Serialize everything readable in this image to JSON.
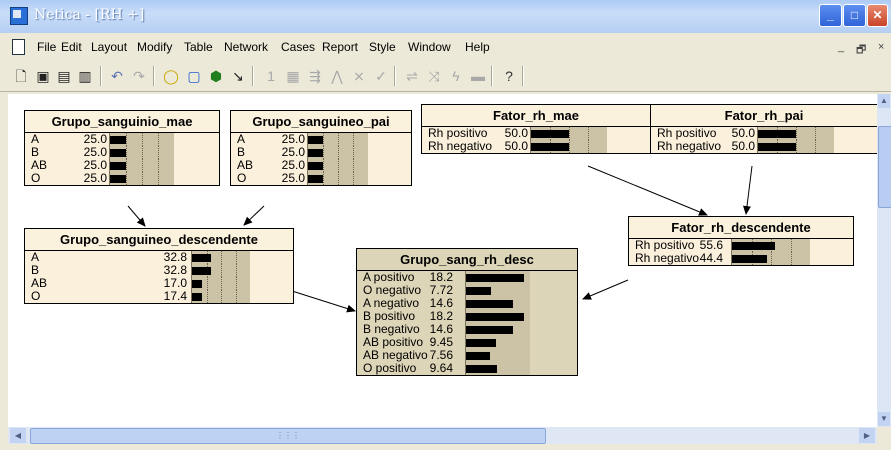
{
  "window": {
    "title": "Netica - [RH +]",
    "minimize": "_",
    "maximize": "□",
    "close": "✕"
  },
  "menu": [
    {
      "label": "File"
    },
    {
      "label": "Edit"
    },
    {
      "label": "Layout"
    },
    {
      "label": "Modify"
    },
    {
      "label": "Table"
    },
    {
      "label": "Network"
    },
    {
      "label": "Cases"
    },
    {
      "label": "Report"
    },
    {
      "label": "Style"
    },
    {
      "label": "Window"
    },
    {
      "label": "Help"
    }
  ],
  "mdi": {
    "minimize": "_",
    "restore": "🗗",
    "close": "×"
  },
  "toolbar": [
    {
      "icon": "new-icon"
    },
    {
      "icon": "save-icon"
    },
    {
      "icon": "compile-icon"
    },
    {
      "icon": "open-icon"
    },
    {
      "icon": "undo-icon"
    },
    {
      "icon": "redo-icon"
    },
    {
      "icon": "nature-node-icon"
    },
    {
      "icon": "decision-node-icon"
    },
    {
      "icon": "utility-node-icon"
    },
    {
      "icon": "link-tool-icon"
    },
    {
      "icon": "one-icon"
    },
    {
      "icon": "table-icon"
    },
    {
      "icon": "arrange-icon"
    },
    {
      "icon": "absorb-icon"
    },
    {
      "icon": "reverse-icon"
    },
    {
      "icon": "check-icon"
    },
    {
      "icon": "transfer-icon"
    },
    {
      "icon": "sensitivity-icon"
    },
    {
      "icon": "findings-icon"
    },
    {
      "icon": "bar-icon"
    },
    {
      "icon": "help-icon"
    }
  ],
  "nodes": {
    "grupo_mae": {
      "title": "Grupo_sanguinio_mae",
      "states": [
        {
          "label": "A",
          "value": "25.0",
          "p": 25.0
        },
        {
          "label": "B",
          "value": "25.0",
          "p": 25.0
        },
        {
          "label": "AB",
          "value": "25.0",
          "p": 25.0
        },
        {
          "label": "O",
          "value": "25.0",
          "p": 25.0
        }
      ]
    },
    "grupo_pai": {
      "title": "Grupo_sanguineo_pai",
      "states": [
        {
          "label": "A",
          "value": "25.0",
          "p": 25.0
        },
        {
          "label": "B",
          "value": "25.0",
          "p": 25.0
        },
        {
          "label": "AB",
          "value": "25.0",
          "p": 25.0
        },
        {
          "label": "O",
          "value": "25.0",
          "p": 25.0
        }
      ]
    },
    "fator_mae": {
      "title": "Fator_rh_mae",
      "states": [
        {
          "label": "Rh positivo",
          "value": "50.0",
          "p": 50.0
        },
        {
          "label": "Rh negativo",
          "value": "50.0",
          "p": 50.0
        }
      ]
    },
    "fator_pai": {
      "title": "Fator_rh_pai",
      "states": [
        {
          "label": "Rh positivo",
          "value": "50.0",
          "p": 50.0
        },
        {
          "label": "Rh negativo",
          "value": "50.0",
          "p": 50.0
        }
      ]
    },
    "fator_desc": {
      "title": "Fator_rh_descendente",
      "states": [
        {
          "label": "Rh positivo",
          "value": "55.6",
          "p": 55.6
        },
        {
          "label": "Rh negativo",
          "value": "44.4",
          "p": 44.4
        }
      ]
    },
    "grupo_desc": {
      "title": "Grupo_sanguineo_descendente",
      "states": [
        {
          "label": "A",
          "value": "32.8",
          "p": 32.8
        },
        {
          "label": "B",
          "value": "32.8",
          "p": 32.8
        },
        {
          "label": "AB",
          "value": "17.0",
          "p": 17.0
        },
        {
          "label": "O",
          "value": "17.4",
          "p": 17.4
        }
      ]
    },
    "grupo_rh": {
      "title": "Grupo_sang_rh_desc",
      "states": [
        {
          "label": "A positivo",
          "value": "18.2",
          "p": 18.2
        },
        {
          "label": "O negativo",
          "value": "7.72",
          "p": 7.72
        },
        {
          "label": "A negativo",
          "value": "14.6",
          "p": 14.6
        },
        {
          "label": "B positivo",
          "value": "18.2",
          "p": 18.2
        },
        {
          "label": "B negativo",
          "value": "14.6",
          "p": 14.6
        },
        {
          "label": "AB positivo",
          "value": "9.45",
          "p": 9.45
        },
        {
          "label": "AB negativo",
          "value": "7.56",
          "p": 7.56
        },
        {
          "label": "O positivo",
          "value": "9.64",
          "p": 9.64
        }
      ]
    }
  },
  "colors": {
    "node_bg": "#faf0dc",
    "selected_node_bg": "#ddd5b7",
    "bar_bg": "#ccc2a6",
    "bar": "#000000"
  }
}
